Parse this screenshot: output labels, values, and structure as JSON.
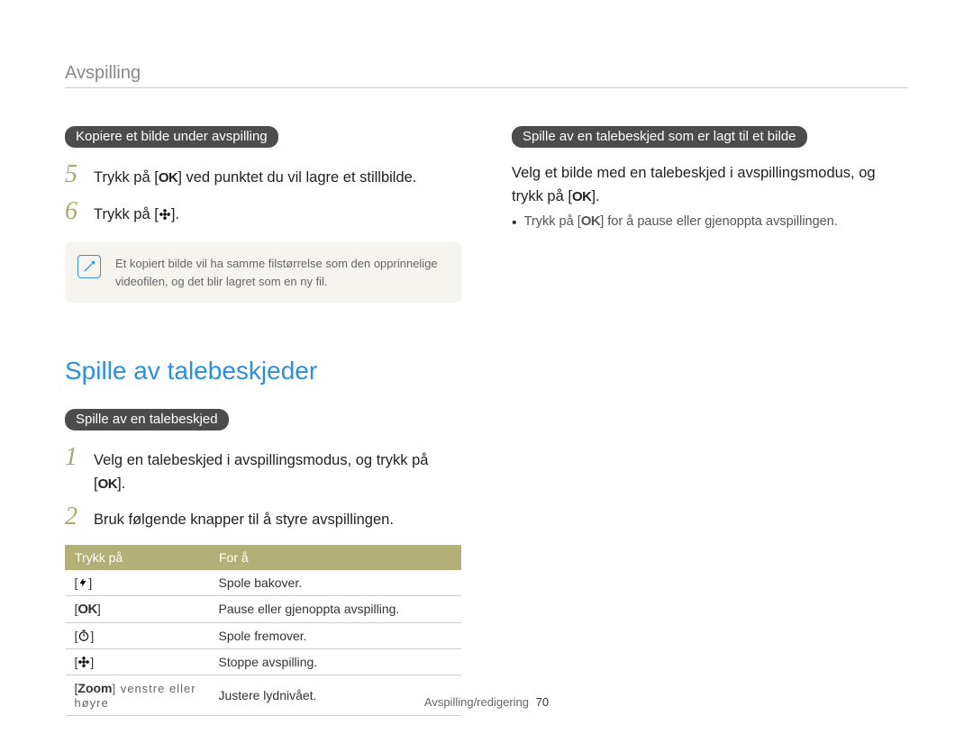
{
  "breadcrumb": "Avspilling",
  "left": {
    "pill1": "Kopiere et bilde under avspilling",
    "step5_pre": "Trykk på [",
    "step5_post": "] ved punktet du vil lagre et stillbilde.",
    "step6_pre": "Trykk på [",
    "step6_post": "].",
    "note": "Et kopiert bilde vil ha samme filstørrelse som den opprinnelige videofilen, og det blir lagret som en ny fil.",
    "section_title": "Spille av talebeskjeder",
    "pill2": "Spille av en talebeskjed",
    "step1_pre": "Velg en talebeskjed i avspillingsmodus, og trykk på [",
    "step1_post": "].",
    "step2": "Bruk følgende knapper til å styre avspillingen.",
    "table": {
      "h1": "Trykk på",
      "h2": "For å",
      "rows": [
        {
          "desc": "Spole bakover."
        },
        {
          "desc": "Pause eller gjenoppta avspilling."
        },
        {
          "desc": "Spole fremover."
        },
        {
          "desc": "Stoppe avspilling."
        },
        {
          "desc": "Justere lydnivået."
        }
      ],
      "zoom_strong": "Zoom",
      "zoom_rest": "] venstre eller høyre"
    }
  },
  "right": {
    "pill": "Spille av en talebeskjed som er lagt til et bilde",
    "body_pre": "Velg et bilde med en talebeskjed i avspillingsmodus, og trykk på [",
    "body_post": "].",
    "bullet_pre": "Trykk på [",
    "bullet_post": "] for å pause eller gjenoppta avspillingen."
  },
  "icons": {
    "ok": "OK"
  },
  "footer": {
    "section": "Avspilling/redigering",
    "page": "70"
  }
}
